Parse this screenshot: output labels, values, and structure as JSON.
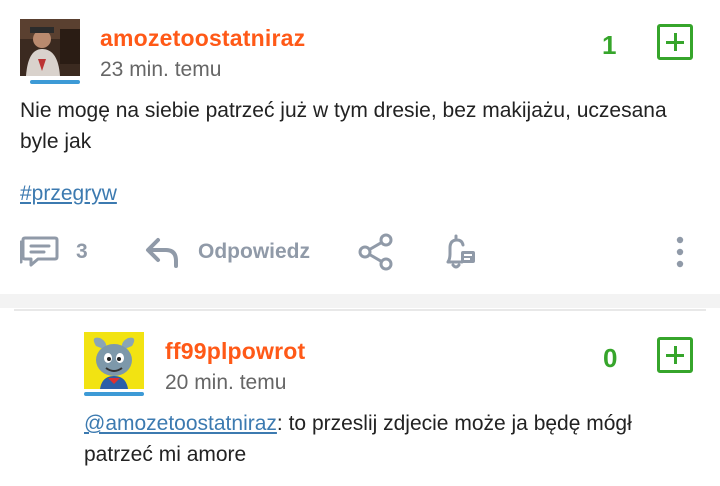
{
  "post": {
    "username": "amozetoostatniraz",
    "time": "23 min. temu",
    "vote_count": "1",
    "body": "Nie mogę na siebie patrzeć już w tym dresie, bez makijażu, uczesana byle jak",
    "tag": "#przegryw",
    "comment_count": "3",
    "reply_label": "Odpowiedz"
  },
  "reply": {
    "username": "ff99plpowrot",
    "time": "20 min. temu",
    "vote_count": "0",
    "mention": "@amozetoostatniraz",
    "text": ": to przeslij zdjecie może ja będę mógł patrzeć mi amore"
  },
  "icons": [
    "comment-icon",
    "reply-icon",
    "share-icon",
    "notification-icon",
    "more-icon",
    "plus-vote-icon"
  ],
  "colors": {
    "username": "#ff5917",
    "vote": "#36a52b",
    "link": "#3c7ab0",
    "avatar_underline": "#3d9ad6",
    "action_gray": "#909aa8"
  }
}
